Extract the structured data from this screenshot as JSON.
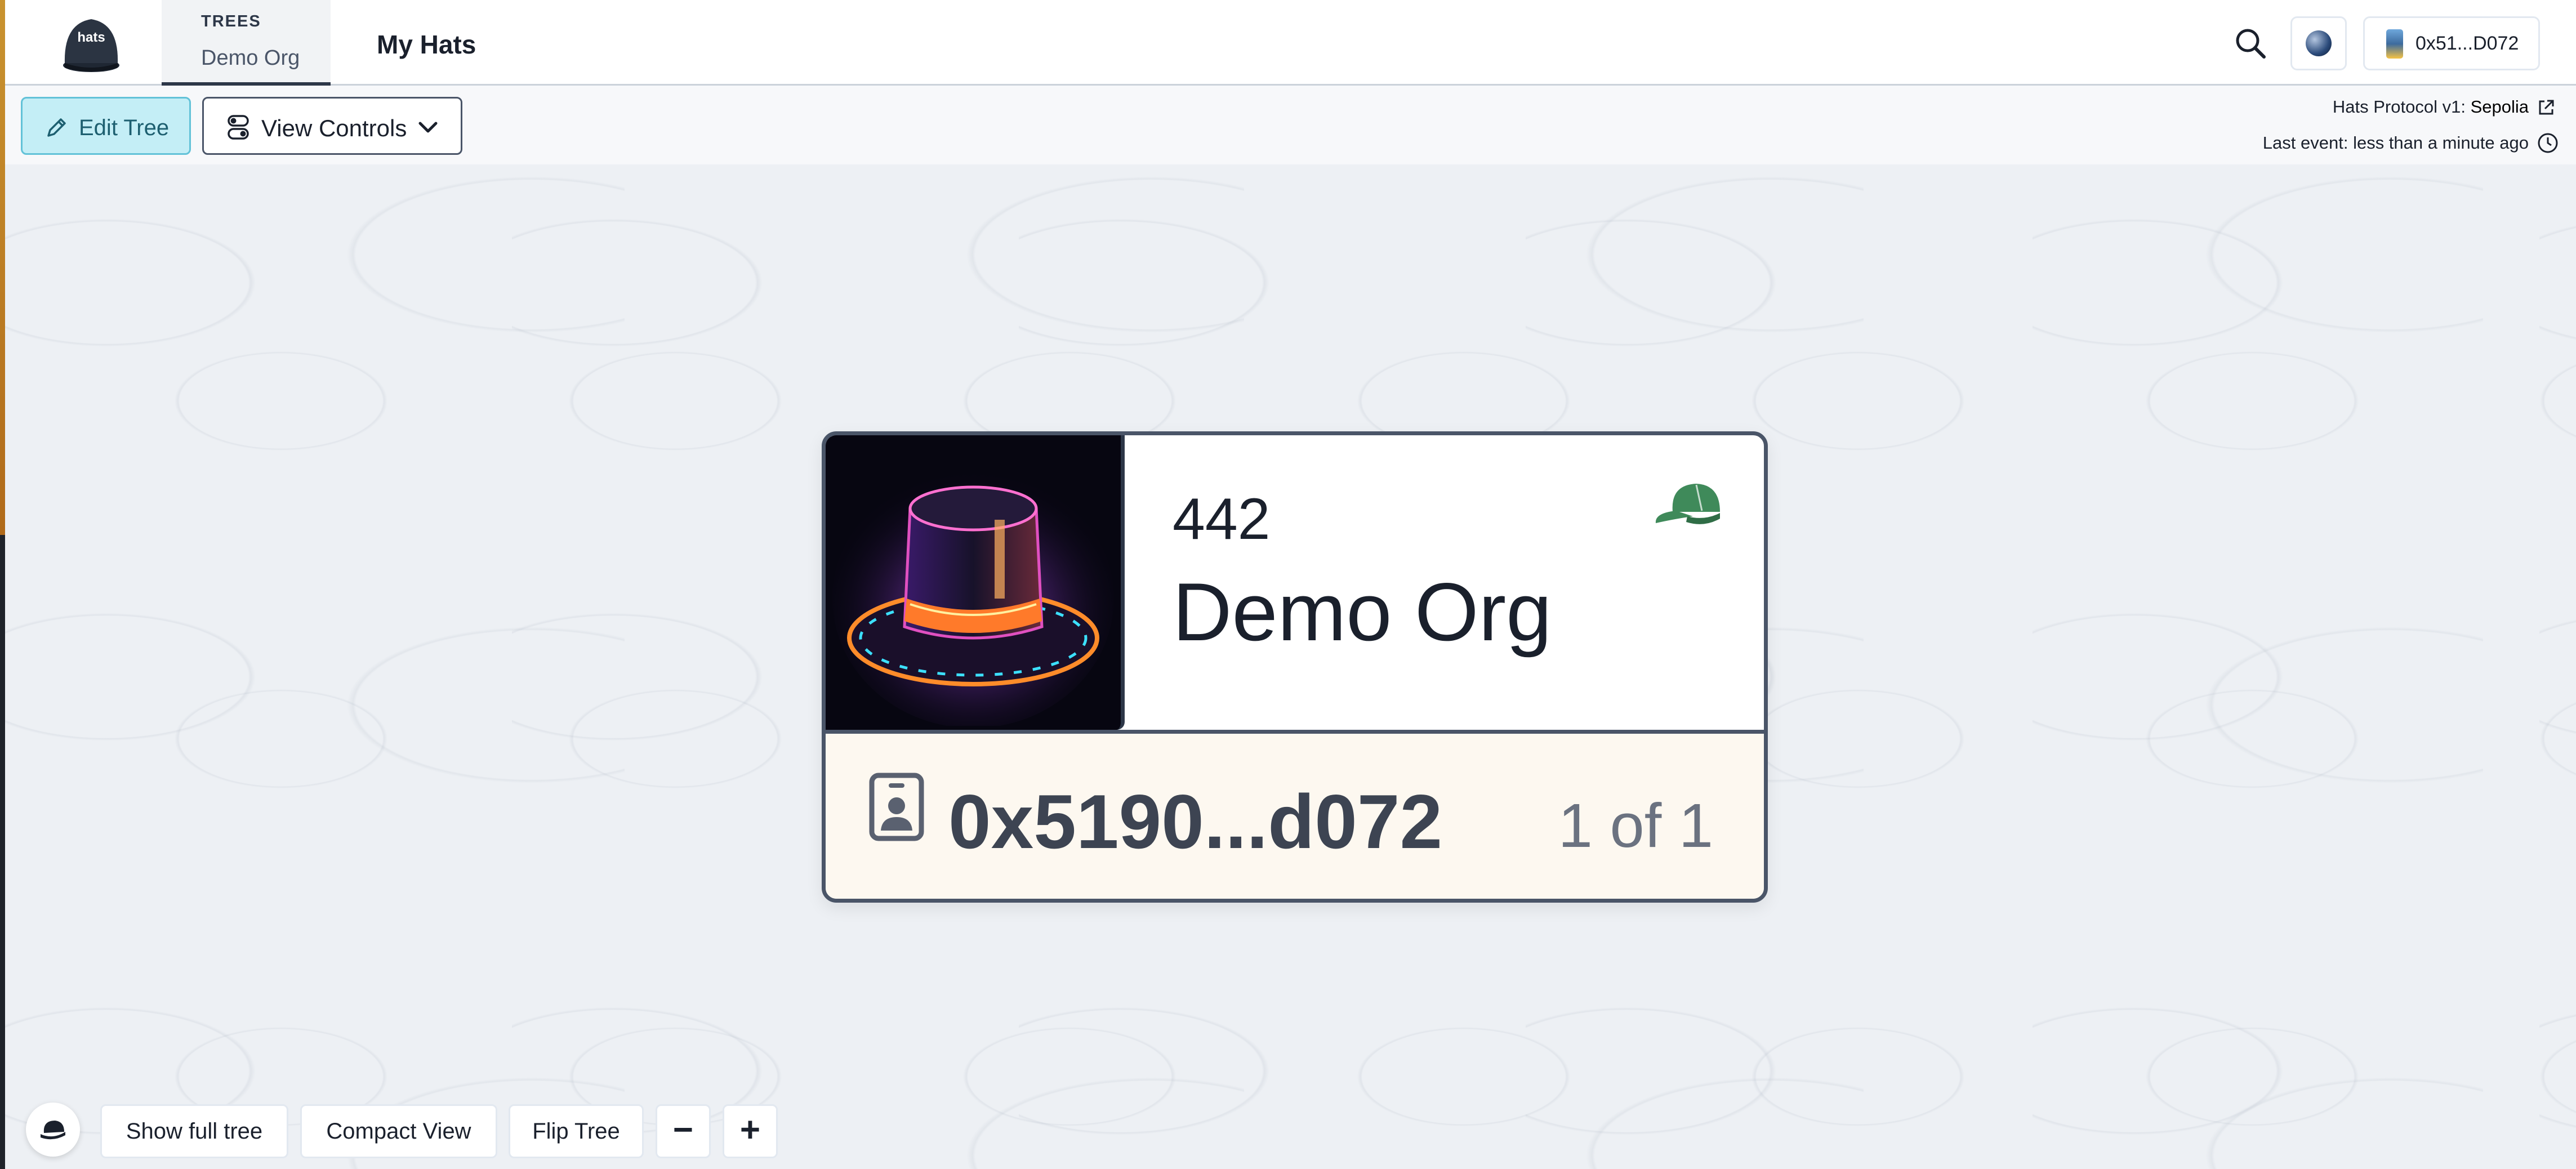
{
  "header": {
    "logo_text": "hats",
    "trees_caption": "TREES",
    "trees_name": "Demo Org",
    "my_hats": "My Hats",
    "account_address": "0x51...D072"
  },
  "toolbar": {
    "edit_tree": "Edit Tree",
    "view_controls": "View Controls",
    "protocol_label": "Hats Protocol v1:",
    "protocol_network": "Sepolia",
    "last_event_label": "Last event:",
    "last_event_value": "less than a minute ago"
  },
  "card": {
    "hat_id": "442",
    "hat_name": "Demo Org",
    "wearer": "0x5190...d072",
    "wearer_count": "1 of 1"
  },
  "controls": {
    "show_full_tree": "Show full tree",
    "compact_view": "Compact View",
    "flip_tree": "Flip Tree",
    "zoom_out": "−",
    "zoom_in": "+"
  },
  "colors": {
    "accent_cyan": "#c4eef6",
    "cap_green": "#3f8a5a",
    "card_border": "#4a5568",
    "wearer_bg": "#fdf8f0"
  },
  "icons": [
    "search-icon",
    "globe-icon",
    "pencil-icon",
    "toggle-icon",
    "chevron-down-icon",
    "external-link-icon",
    "clock-icon",
    "cap-icon",
    "id-badge-icon",
    "hat-icon"
  ]
}
